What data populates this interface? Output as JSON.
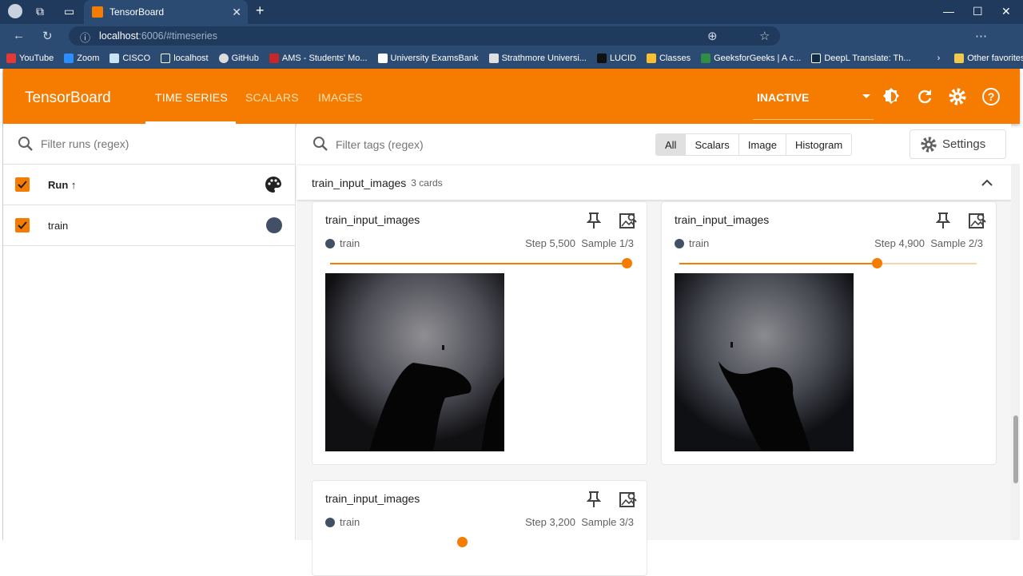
{
  "browser": {
    "tab_title": "TensorBoard",
    "url_host": "localhost",
    "url_rest": ":6006/#timeseries",
    "bookmarks": [
      "YouTube",
      "Zoom",
      "CISCO",
      "localhost",
      "GitHub",
      "AMS - Students' Mo...",
      "University ExamsBank",
      "Strathmore Universi...",
      "LUCID",
      "Classes",
      "GeeksforGeeks | A c...",
      "DeepL Translate: Th..."
    ],
    "other_favorites": "Other favorites"
  },
  "toolbar": {
    "brand": "TensorBoard",
    "tabs": [
      "TIME SERIES",
      "SCALARS",
      "IMAGES"
    ],
    "status": "INACTIVE",
    "accent": "#f57c00"
  },
  "runs_panel": {
    "filter_placeholder": "Filter runs (regex)",
    "header": "Run ↑",
    "runs": [
      {
        "name": "train",
        "color": "#425066",
        "checked": true
      }
    ]
  },
  "main": {
    "filter_placeholder": "Filter tags (regex)",
    "type_filters": [
      "All",
      "Scalars",
      "Image",
      "Histogram"
    ],
    "selected_filter": "All",
    "settings_label": "Settings",
    "group": {
      "name": "train_input_images",
      "count_label": "3 cards"
    },
    "cards": [
      {
        "title": "train_input_images",
        "run": "train",
        "step": "Step 5,500",
        "sample": "Sample 1/3",
        "slider_fraction": 1.0
      },
      {
        "title": "train_input_images",
        "run": "train",
        "step": "Step 4,900",
        "sample": "Sample 2/3",
        "slider_fraction": 0.67
      },
      {
        "title": "train_input_images",
        "run": "train",
        "step": "Step 3,200",
        "sample": "Sample 3/3",
        "slider_fraction": 0.45
      }
    ]
  }
}
